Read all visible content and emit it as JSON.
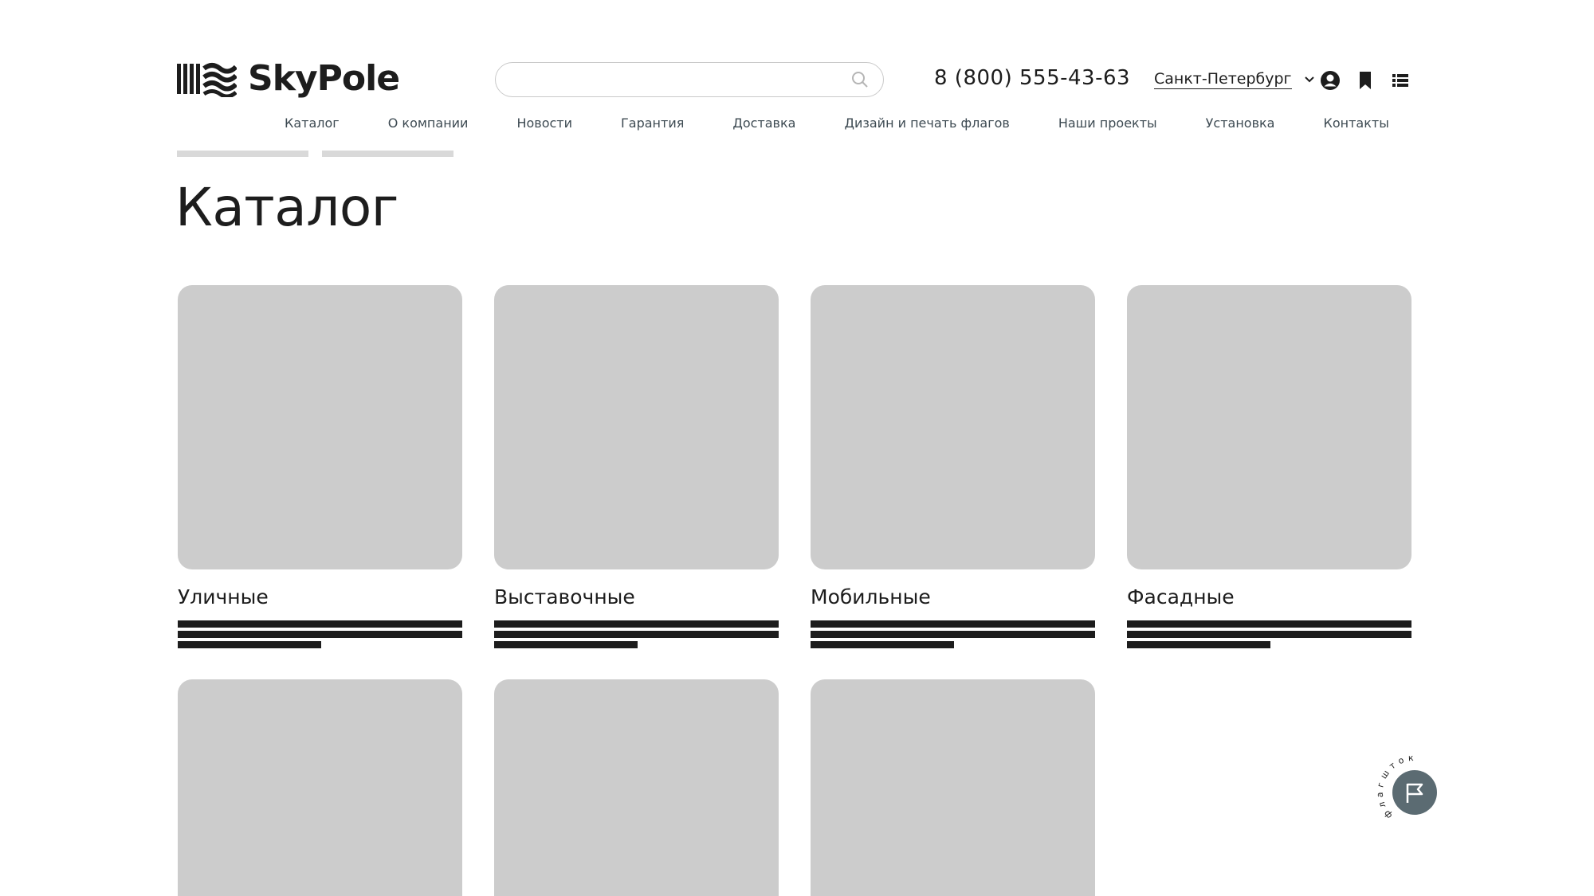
{
  "brand": {
    "name": "SkyPole"
  },
  "search": {
    "placeholder": ""
  },
  "header": {
    "phone": "8 (800) 555-43-63",
    "city": "Санкт-Петербург"
  },
  "nav": {
    "items": [
      "Каталог",
      "О компании",
      "Новости",
      "Гарантия",
      "Доставка",
      "Дизайн и печать флагов",
      "Наши проекты",
      "Установка",
      "Контакты"
    ]
  },
  "page": {
    "title": "Каталог"
  },
  "catalog": {
    "cards": [
      {
        "title": "Уличные"
      },
      {
        "title": "Выставочные"
      },
      {
        "title": "Мобильные"
      },
      {
        "title": "Фасадные"
      },
      {
        "title": ""
      },
      {
        "title": ""
      },
      {
        "title": ""
      }
    ]
  },
  "fab": {
    "ring_text": "флагштоки",
    "icon": "flag-icon"
  },
  "colors": {
    "text": "#1d1d1d",
    "nav_text": "#3d4a52",
    "placeholder_gray": "#cccccc",
    "fab_bg": "#5b6b72"
  }
}
